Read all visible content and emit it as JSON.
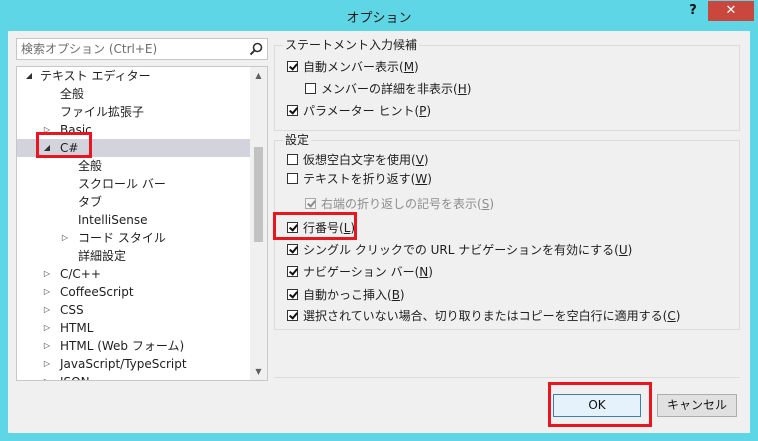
{
  "window": {
    "title": "オプション",
    "help_label": "?",
    "close_label": "✕"
  },
  "search": {
    "placeholder": "検索オプション (Ctrl+E)",
    "icon": "search-icon"
  },
  "tree": {
    "items": [
      {
        "label": "テキスト エディター",
        "expander": "◢"
      },
      {
        "label": "全般"
      },
      {
        "label": "ファイル拡張子"
      },
      {
        "label": "Basic",
        "expander": "▷"
      },
      {
        "label": "C#",
        "expander": "◢"
      },
      {
        "label": "全般"
      },
      {
        "label": "スクロール バー"
      },
      {
        "label": "タブ"
      },
      {
        "label": "IntelliSense"
      },
      {
        "label": "コード スタイル",
        "expander": "▷"
      },
      {
        "label": "詳細設定"
      },
      {
        "label": "C/C++",
        "expander": "▷"
      },
      {
        "label": "CoffeeScript",
        "expander": "▷"
      },
      {
        "label": "CSS",
        "expander": "▷"
      },
      {
        "label": "HTML",
        "expander": "▷"
      },
      {
        "label": "HTML (Web フォーム)",
        "expander": "▷"
      },
      {
        "label": "JavaScript/TypeScript",
        "expander": "▷"
      },
      {
        "label": "JSON",
        "expander": "▷"
      }
    ],
    "selected": "C#",
    "scroll_up": "▲",
    "scroll_down": "▼"
  },
  "statement_completion": {
    "legend": "ステートメント入力候補",
    "options": [
      {
        "text": "自動メンバー表示(",
        "key": "M",
        "suffix": ")",
        "checked": true
      },
      {
        "text": "メンバーの詳細を非表示(",
        "key": "H",
        "suffix": ")",
        "checked": false
      },
      {
        "text": "パラメーター ヒント(",
        "key": "P",
        "suffix": ")",
        "checked": true
      }
    ]
  },
  "settings": {
    "legend": "設定",
    "options": [
      {
        "text": "仮想空白文字を使用(",
        "key": "V",
        "suffix": ")",
        "checked": false
      },
      {
        "text": "テキストを折り返す(",
        "key": "W",
        "suffix": ")",
        "checked": false
      },
      {
        "text": "右端の折り返しの記号を表示(",
        "key": "S",
        "suffix": ")",
        "checked": true,
        "disabled": true
      },
      {
        "text": "行番号(",
        "key": "L",
        "suffix": ")",
        "checked": true
      },
      {
        "text": "シングル クリックでの URL ナビゲーションを有効にする(",
        "key": "U",
        "suffix": ")",
        "checked": true
      },
      {
        "text": "ナビゲーション バー(",
        "key": "N",
        "suffix": ")",
        "checked": true
      },
      {
        "text": "自動かっこ挿入(",
        "key": "B",
        "suffix": ")",
        "checked": true
      },
      {
        "text": "選択されていない場合、切り取りまたはコピーを空白行に適用する(",
        "key": "C",
        "suffix": ")",
        "checked": true
      }
    ]
  },
  "buttons": {
    "ok": "OK",
    "cancel": "キャンセル"
  },
  "colors": {
    "title_bar": "#5fd6e6",
    "close_button": "#c9473c",
    "highlight_box": "#e8161e",
    "selected_row": "#d3d3dd"
  }
}
